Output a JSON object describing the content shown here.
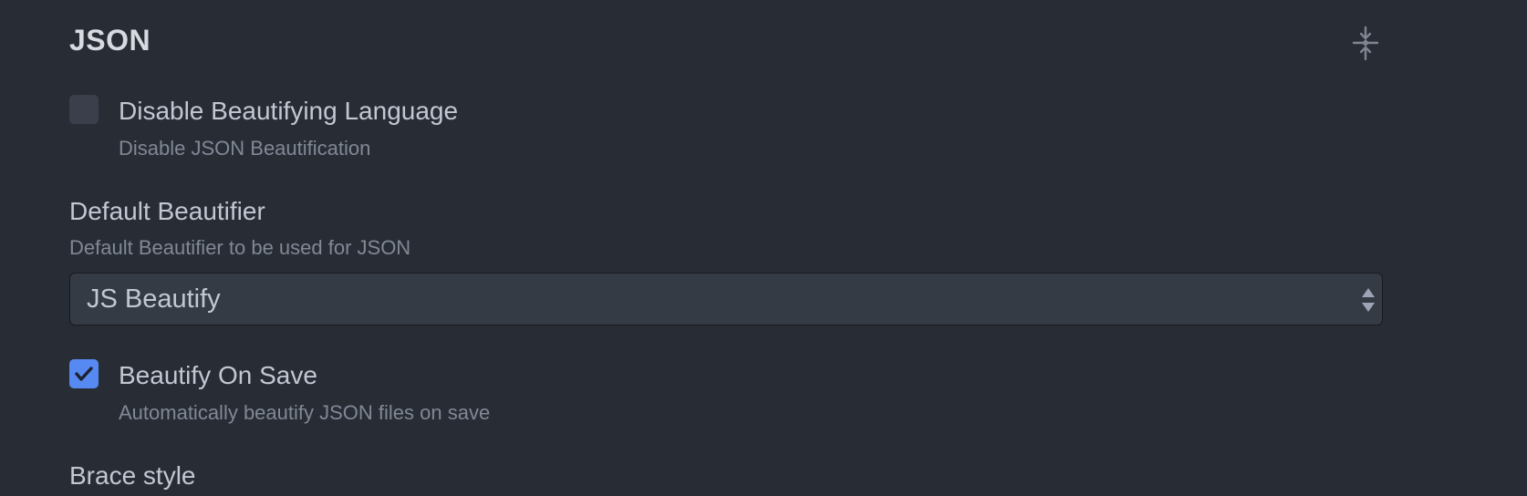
{
  "section": {
    "title": "JSON",
    "collapse_icon": "fold-icon"
  },
  "settings": {
    "disable_beautifying": {
      "label": "Disable Beautifying Language",
      "description": "Disable JSON Beautification",
      "checked": false
    },
    "default_beautifier": {
      "label": "Default Beautifier",
      "description": "Default Beautifier to be used for JSON",
      "selected": "JS Beautify"
    },
    "beautify_on_save": {
      "label": "Beautify On Save",
      "description": "Automatically beautify JSON files on save",
      "checked": true
    },
    "brace_style": {
      "label": "Brace style"
    }
  },
  "colors": {
    "background": "#282c34",
    "accent": "#568af2",
    "text": "#c2c8d3",
    "muted_text": "#818896"
  }
}
